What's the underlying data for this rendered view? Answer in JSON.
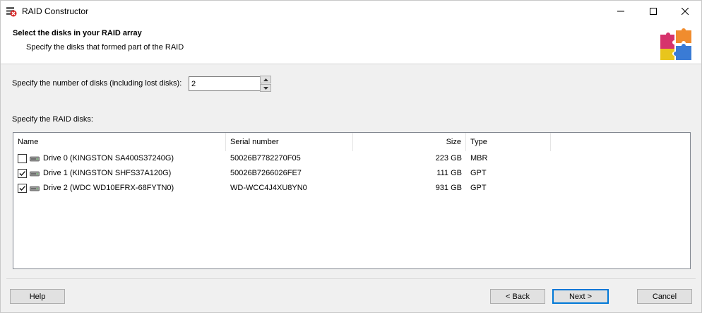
{
  "window": {
    "title": "RAID Constructor",
    "icon": "raid-app-icon",
    "controls": [
      "minimize-icon",
      "maximize-icon",
      "close-icon"
    ]
  },
  "header": {
    "title": "Select the disks in your RAID array",
    "subtitle": "Specify the disks that formed part of the RAID",
    "logo": "puzzle-icon"
  },
  "disk_count": {
    "label": "Specify the number of disks (including lost disks):",
    "value": "2"
  },
  "disks_section": {
    "label": "Specify the RAID disks:",
    "columns": {
      "name": "Name",
      "serial": "Serial number",
      "size": "Size",
      "type": "Type"
    },
    "rows": [
      {
        "checked": false,
        "name": "Drive 0 (KINGSTON SA400S37240G)",
        "serial": "50026B7782270F05",
        "size": "223 GB",
        "type": "MBR"
      },
      {
        "checked": true,
        "name": "Drive 1 (KINGSTON SHFS37A120G)",
        "serial": "50026B7266026FE7",
        "size": "111 GB",
        "type": "GPT"
      },
      {
        "checked": true,
        "name": "Drive 2 (WDC WD10EFRX-68FYTN0)",
        "serial": "WD-WCC4J4XU8YN0",
        "size": "931 GB",
        "type": "GPT"
      }
    ]
  },
  "buttons": {
    "help": "Help",
    "back": "< Back",
    "next": "Next >",
    "cancel": "Cancel"
  },
  "colors": {
    "accent": "#0078d7",
    "background": "#f0f0f0"
  }
}
